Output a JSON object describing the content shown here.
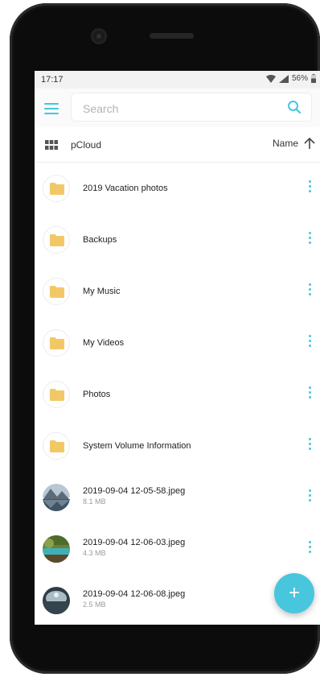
{
  "status_bar": {
    "time": "17:17",
    "battery": "56%"
  },
  "search": {
    "placeholder": "Search"
  },
  "list_header": {
    "breadcrumb": "pCloud",
    "sort_label": "Name"
  },
  "items": [
    {
      "name": "2019 Vacation photos",
      "type": "folder",
      "icon": "folder-icon"
    },
    {
      "name": "Backups",
      "type": "folder",
      "icon": "folder-icon"
    },
    {
      "name": "My Music",
      "type": "folder",
      "icon": "folder-icon"
    },
    {
      "name": "My Videos",
      "type": "folder",
      "icon": "folder-icon"
    },
    {
      "name": "Photos",
      "type": "folder",
      "icon": "folder-icon"
    },
    {
      "name": "System Volume Information",
      "type": "folder",
      "icon": "folder-icon"
    },
    {
      "name": "2019-09-04 12-05-58.jpeg",
      "size": "8.1 MB",
      "type": "image",
      "icon": "image-thumbnail"
    },
    {
      "name": "2019-09-04 12-06-03.jpeg",
      "size": "4.3 MB",
      "type": "image",
      "icon": "image-thumbnail"
    },
    {
      "name": "2019-09-04 12-06-08.jpeg",
      "size": "2.5 MB",
      "type": "image",
      "icon": "image-thumbnail"
    }
  ],
  "fab": {
    "label": "+"
  },
  "colors": {
    "accent": "#45c6de",
    "folder": "#f2c867"
  }
}
